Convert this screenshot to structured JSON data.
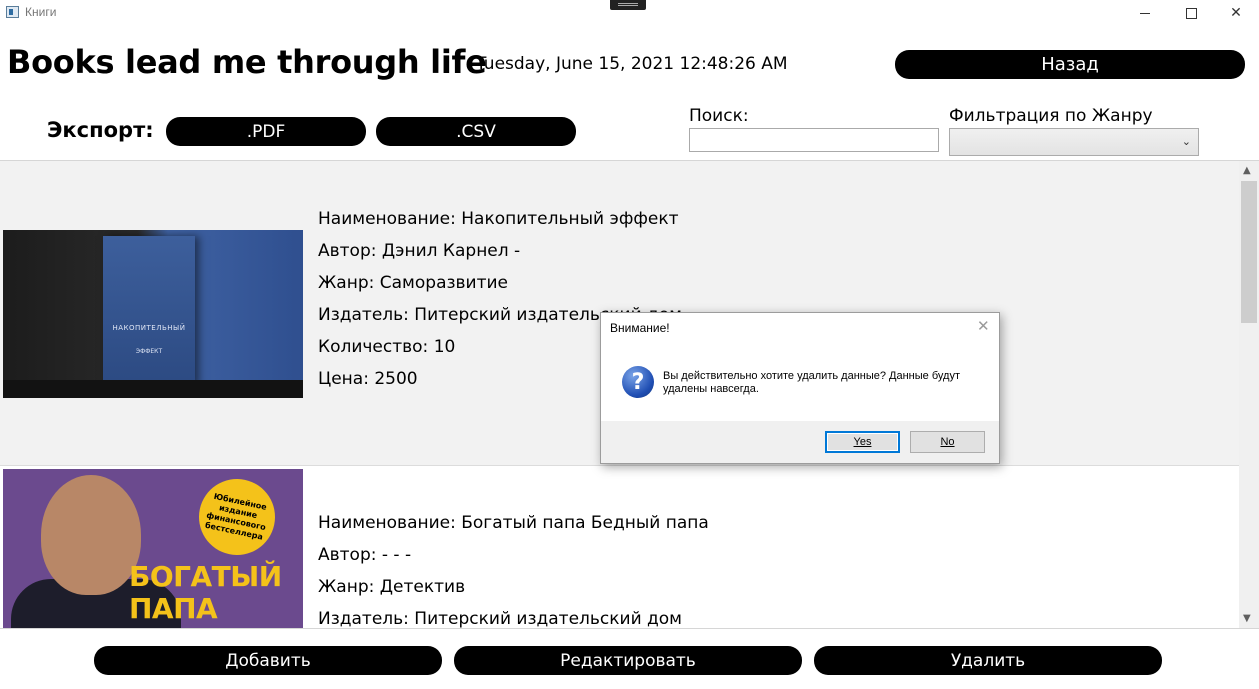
{
  "window": {
    "title": "Книги",
    "minimize_glyph": "—",
    "close_glyph": "✕"
  },
  "header": {
    "heading": "Books lead me through life",
    "datetime": "Tuesday, June 15, 2021 12:48:26 AM",
    "back_label": "Назад"
  },
  "toolbar": {
    "export_label": "Экспорт:",
    "pdf_label": ".PDF",
    "csv_label": ".CSV",
    "search_label": "Поиск:",
    "search_value": "",
    "filter_label": "Фильтрация по Жанру",
    "filter_value": ""
  },
  "books": [
    {
      "name": "Наименование: Накопительный эффект",
      "author": "Автор: Дэнил Карнел -",
      "genre": "Жанр: Саморазвитие",
      "publisher": "Издатель: Питерский издательский дом",
      "quantity": "Количество: 10",
      "price": "Цена: 2500",
      "cover_title": "НАКОПИТЕЛЬНЫЙ",
      "cover_subtitle": "ЭФФЕКТ"
    },
    {
      "name": "Наименование: Богатый папа Бедный папа",
      "author": "Автор: - - -",
      "genre": "Жанр: Детектив",
      "publisher": "Издатель: Питерский издательский дом",
      "cover_badge": "Юбилейное издание финансового бестселлера",
      "cover_title": "БОГАТЫЙ ПАПА"
    }
  ],
  "actions": {
    "add_label": "Добавить",
    "edit_label": "Редактировать",
    "delete_label": "Удалить"
  },
  "dialog": {
    "title": "Внимание!",
    "close_glyph": "✕",
    "icon_glyph": "?",
    "message": "Вы действительно хотите удалить данные? Данные будут удалены навсегда.",
    "yes_label": "Yes",
    "no_label": "No"
  },
  "scrollbar": {
    "up_glyph": "▲",
    "down_glyph": "▼"
  }
}
